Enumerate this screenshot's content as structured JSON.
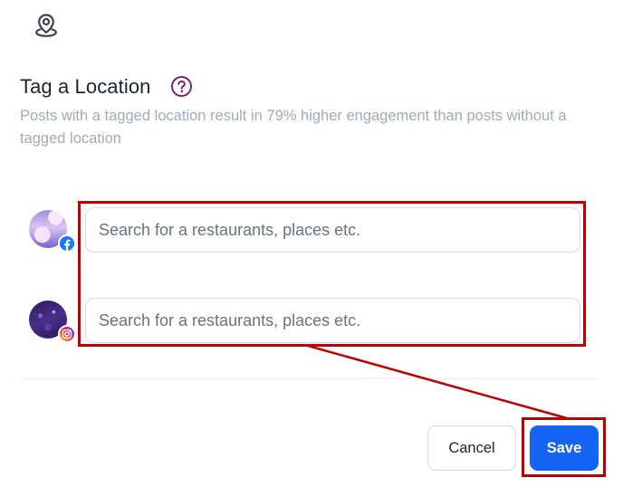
{
  "header": {
    "title": "Tag a Location",
    "subtitle": "Posts with a tagged location result in 79% higher engagement than posts without a tagged location",
    "location_icon": "map-pin-icon",
    "help_icon": "question-circle-icon"
  },
  "accounts": [
    {
      "platform_icon": "facebook-icon",
      "search": {
        "value": "",
        "placeholder": "Search for a restaurants, places etc."
      }
    },
    {
      "platform_icon": "instagram-icon",
      "search": {
        "value": "",
        "placeholder": "Search for a restaurants, places etc."
      }
    }
  ],
  "footer": {
    "cancel_label": "Cancel",
    "save_label": "Save"
  },
  "colors": {
    "primary": "#1463f3",
    "help_icon": "#7b1f7e",
    "subtitle_text": "#a3a9b6",
    "annotation": "#c00000",
    "facebook": "#1877f2"
  }
}
